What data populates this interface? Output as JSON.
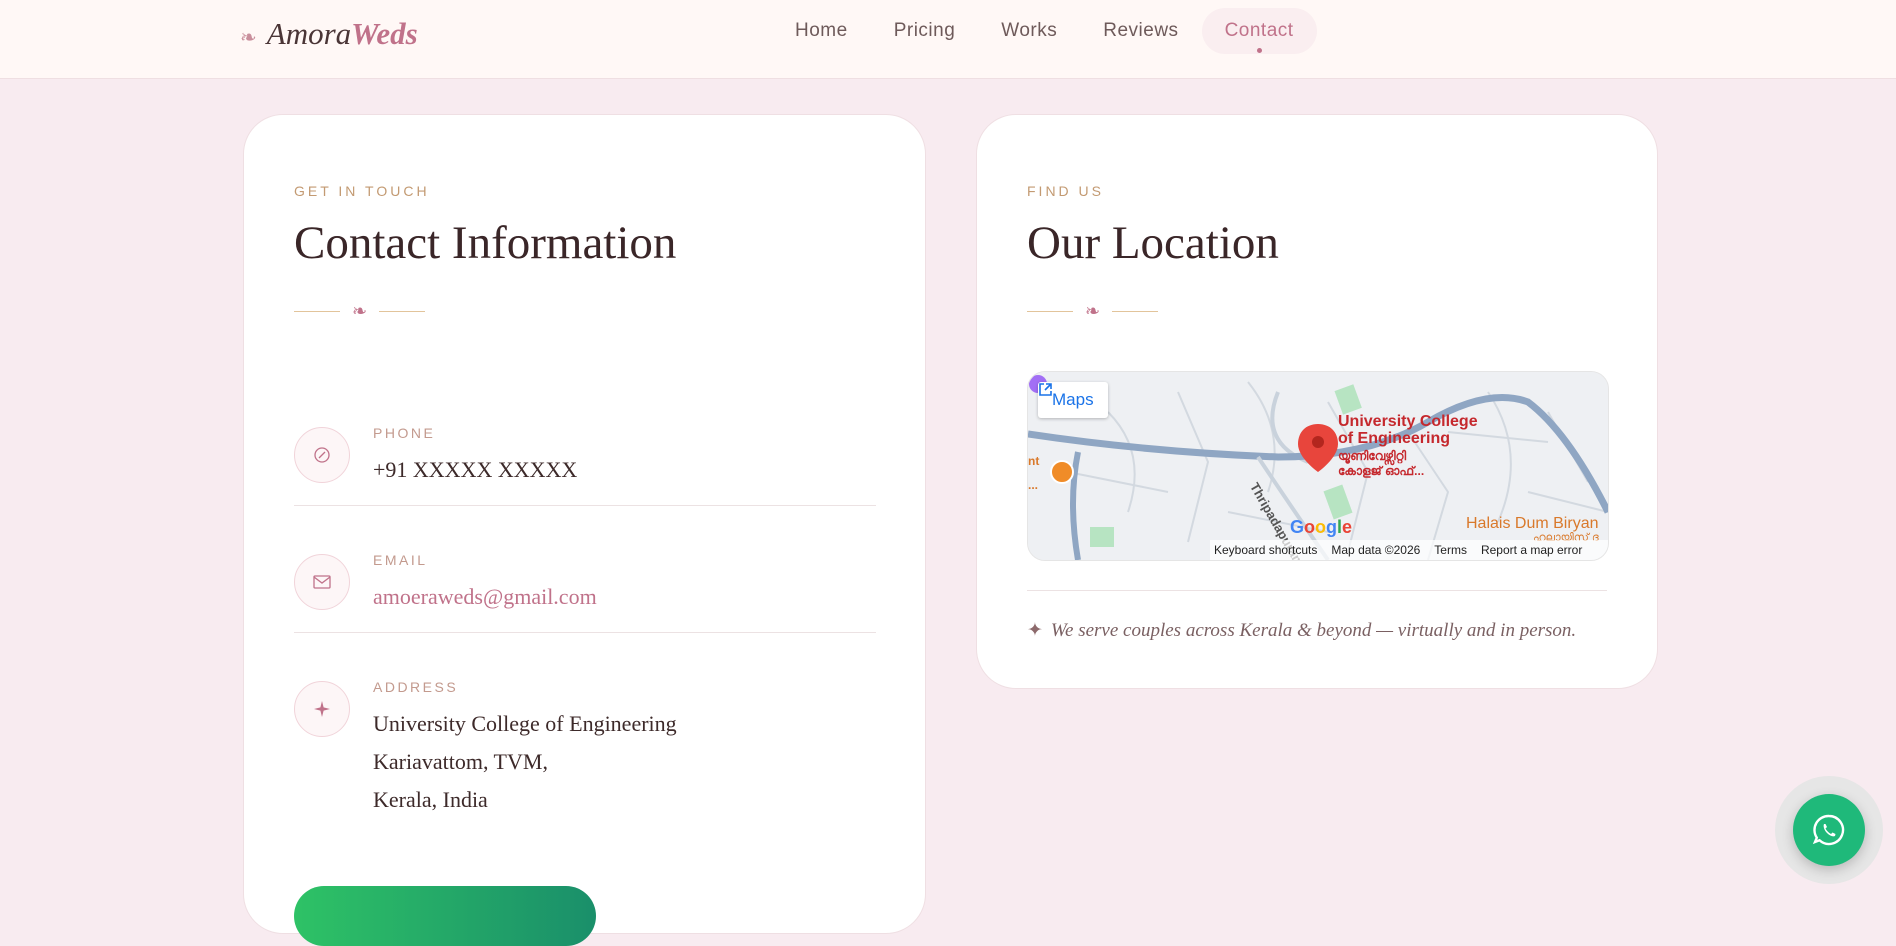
{
  "header": {
    "logo_glyph": "❧",
    "logo_part1": "Amora",
    "logo_part2": "Weds",
    "nav": [
      {
        "label": "Home"
      },
      {
        "label": "Pricing"
      },
      {
        "label": "Works"
      },
      {
        "label": "Reviews"
      },
      {
        "label": "Contact",
        "active": true
      }
    ]
  },
  "contact_card": {
    "eyebrow": "GET IN TOUCH",
    "title": "Contact Information",
    "ornament": "❧",
    "phone": {
      "label": "PHONE",
      "value": "+91 XXXXX XXXXX",
      "icon": "phone-icon"
    },
    "email": {
      "label": "EMAIL",
      "value": "amoeraweds@gmail.com",
      "icon": "mail-icon"
    },
    "address": {
      "label": "ADDRESS",
      "icon": "sparkle-icon",
      "lines": [
        "University College of Engineering",
        "Kariavattom, TVM,",
        "Kerala, India"
      ]
    }
  },
  "location_card": {
    "eyebrow": "FIND US",
    "title": "Our Location",
    "ornament": "❧",
    "map": {
      "maps_button": "Maps",
      "place_name_1": "University College",
      "place_name_2": "of Engineering",
      "place_local_1": "യൂണിവേഴ്സിറ്റി",
      "place_local_2": "കോളജ് ഓഫ്...",
      "restaurant": "Halais Dum Biryan",
      "restaurant_local": "ഹലായിസ് ദ",
      "road": "Thripadapuram",
      "edge_text_1": "nt",
      "edge_text_2": "...",
      "google": "Google",
      "footer": [
        "Keyboard shortcuts",
        "Map data ©2026",
        "Terms",
        "Report a map error"
      ]
    },
    "tagline": "We serve couples across Kerala & beyond — virtually and in person.",
    "tagline_star": "✦"
  },
  "colors": {
    "accent": "#c0728a",
    "background": "#f8ebf0",
    "whatsapp": "#1fb97a"
  }
}
